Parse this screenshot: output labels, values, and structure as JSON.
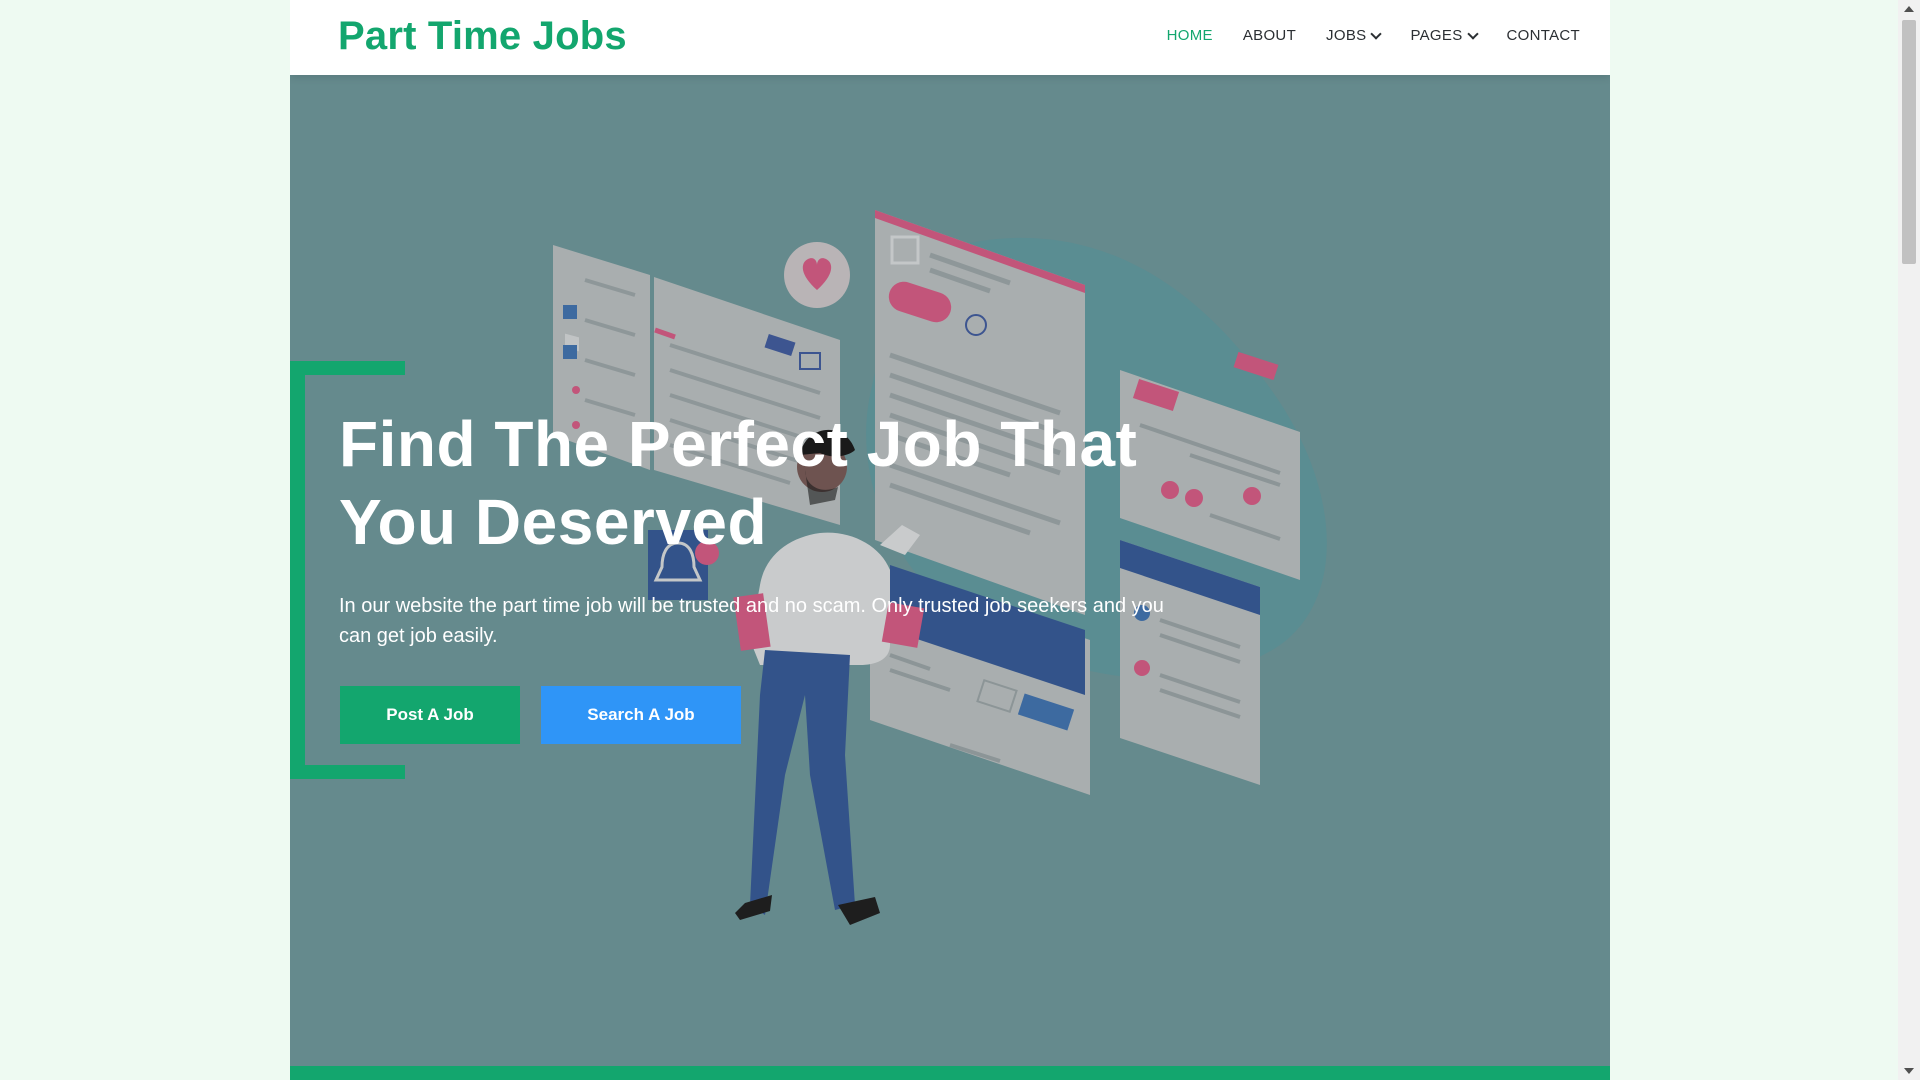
{
  "brand": {
    "name": "Part Time Jobs",
    "color": "#13a66e"
  },
  "nav": {
    "items": [
      {
        "label": "HOME",
        "active": true,
        "dropdown": false
      },
      {
        "label": "ABOUT",
        "active": false,
        "dropdown": false
      },
      {
        "label": "JOBS",
        "active": false,
        "dropdown": true
      },
      {
        "label": "PAGES",
        "active": false,
        "dropdown": true
      },
      {
        "label": "CONTACT",
        "active": false,
        "dropdown": false
      }
    ]
  },
  "hero": {
    "title_line1": "Find The Perfect Job That",
    "title_line2": "You Deserved",
    "subtitle": "In our website the part time job will be trusted and no scam. Only trusted job seekers and you can get job easily.",
    "buttons": {
      "post": "Post A Job",
      "search": "Search A Job"
    },
    "overlay_color": "#658a8d"
  },
  "colors": {
    "accent": "#13a66e",
    "secondary": "#2f95f7",
    "page_bg": "#eefaf2"
  },
  "icons": [
    "chevron-down-icon",
    "heart-icon",
    "bell-icon"
  ]
}
